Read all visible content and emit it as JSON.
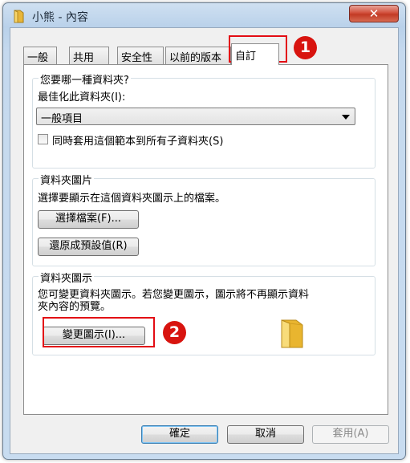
{
  "window": {
    "title": "小熊 - 內容",
    "close_label": "✕"
  },
  "tabs": [
    {
      "label": "一般"
    },
    {
      "label": "共用"
    },
    {
      "label": "安全性"
    },
    {
      "label": "以前的版本"
    },
    {
      "label": "自訂",
      "selected": true
    }
  ],
  "folder_type": {
    "group_label": "您要哪一種資料夾?",
    "optimize_label": "最佳化此資料夾(I):",
    "selected_option": "一般項目",
    "apply_checkbox_label": "同時套用這個範本到所有子資料夾(S)",
    "apply_checked": false
  },
  "folder_pictures": {
    "group_label": "資料夾圖片",
    "description": "選擇要顯示在這個資料夾圖示上的檔案。",
    "choose_file_button": "選擇檔案(F)...",
    "restore_default_button": "還原成預設值(R)"
  },
  "folder_icons": {
    "group_label": "資料夾圖示",
    "description_line1": "您可變更資料夾圖示。若您變更圖示，圖示將不再顯示資料",
    "description_line2": "夾內容的預覽。",
    "change_icon_button": "變更圖示(I)..."
  },
  "footer": {
    "ok": "確定",
    "cancel": "取消",
    "apply": "套用(A)"
  },
  "annotations": {
    "badge1": "1",
    "badge2": "2"
  },
  "colors": {
    "highlight": "#e30c14",
    "badge": "#d8140f"
  }
}
